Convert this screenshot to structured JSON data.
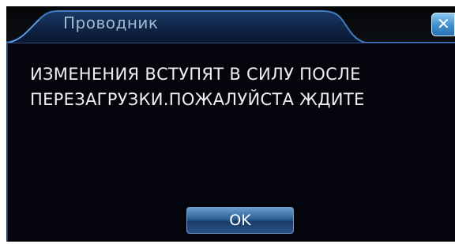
{
  "window": {
    "title": "Проводник",
    "close_icon": "close-icon"
  },
  "message": {
    "line1": "ИЗМЕНЕНИЯ ВСТУПЯТ В СИЛУ ПОСЛЕ",
    "line2": "ПЕРЕЗАГРУЗКИ.ПОЖАЛУЙСТА ЖДИТЕ"
  },
  "buttons": {
    "ok_label": "OK"
  },
  "colors": {
    "dialog_background": "#03040c",
    "title_text": "#9fbcd6",
    "message_text": "#eef0f4",
    "button_blue": "#2d5f97"
  }
}
